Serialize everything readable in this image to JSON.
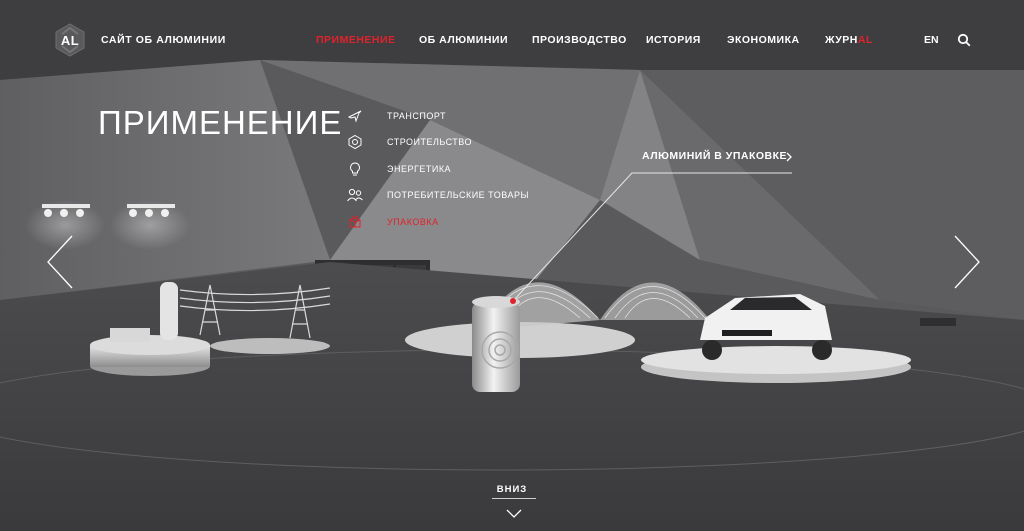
{
  "header": {
    "logo_text": "AL",
    "site_title": "САЙТ ОБ АЛЮМИНИИ",
    "nav": [
      {
        "label": "ПРИМЕНЕНИЕ",
        "active": true
      },
      {
        "label": "ОБ АЛЮМИНИИ"
      },
      {
        "label": "ПРОИЗВОДСТВО"
      },
      {
        "label": "ИСТОРИЯ"
      },
      {
        "label": "ЭКОНОМИКА"
      },
      {
        "label": "ЖУРН",
        "suffix": "AL"
      }
    ],
    "lang": "EN",
    "search_icon": "search-icon"
  },
  "section": {
    "title": "ПРИМЕНЕНИЕ",
    "submenu": [
      {
        "label": "ТРАНСПОРТ",
        "icon": "plane-icon"
      },
      {
        "label": "СТРОИТЕЛЬСТВО",
        "icon": "hexagon-icon"
      },
      {
        "label": "ЭНЕРГЕТИКА",
        "icon": "bulb-icon"
      },
      {
        "label": "ПОТРЕБИТЕЛЬСКИЕ ТОВАРЫ",
        "icon": "people-icon"
      },
      {
        "label": "УПАКОВКА",
        "icon": "box-icon",
        "active": true
      }
    ]
  },
  "callout": {
    "label": "АЛЮМИНИЙ В УПАКОВКЕ"
  },
  "footer": {
    "down_label": "ВНИЗ"
  },
  "colors": {
    "accent": "#e0222b",
    "text": "#ffffff",
    "background": "#4a4a4c"
  }
}
